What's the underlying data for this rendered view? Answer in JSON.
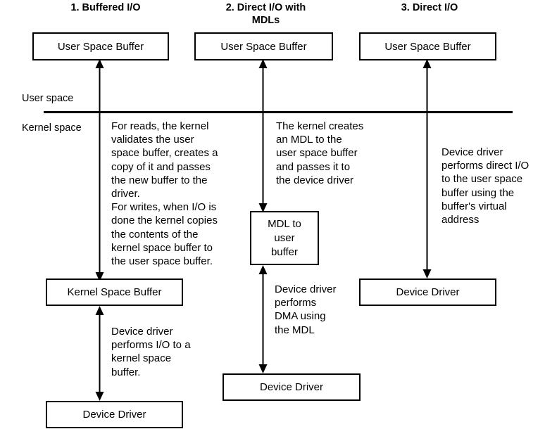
{
  "diagram": {
    "title_columns": [
      {
        "id": "col1",
        "label": "1.  Buffered I/O"
      },
      {
        "id": "col2",
        "label": "2.  Direct I/O with\nMDLs"
      },
      {
        "id": "col3",
        "label": "3. Direct I/O"
      }
    ],
    "space_labels": {
      "user": "User space",
      "kernel": "Kernel space"
    },
    "boxes": [
      {
        "id": "c1-user-space-buffer",
        "label": "User Space Buffer"
      },
      {
        "id": "c2-user-space-buffer",
        "label": "User Space Buffer"
      },
      {
        "id": "c3-user-space-buffer",
        "label": "User Space Buffer"
      },
      {
        "id": "c1-kernel-space-buffer",
        "label": "Kernel Space Buffer"
      },
      {
        "id": "c1-device-driver",
        "label": "Device Driver"
      },
      {
        "id": "c2-mdl-to-user-buffer",
        "label": "MDL to\nuser\nbuffer"
      },
      {
        "id": "c2-device-driver",
        "label": "Device Driver"
      },
      {
        "id": "c3-device-driver",
        "label": "Device Driver"
      }
    ],
    "notes": [
      {
        "id": "c1-note-top",
        "text": "For reads, the kernel\nvalidates the user\nspace buffer, creates a\ncopy of it and passes\nthe new buffer to the\ndriver.\nFor writes, when I/O is\ndone the kernel copies\nthe contents of the\nkernel space buffer to\nthe user space buffer."
      },
      {
        "id": "c1-note-bottom",
        "text": "Device driver\nperforms I/O to a\nkernel space\nbuffer."
      },
      {
        "id": "c2-note-top",
        "text": "The kernel creates\nan MDL to the\nuser space buffer\nand passes it to\nthe device driver"
      },
      {
        "id": "c2-note-bottom",
        "text": "Device driver\nperforms\nDMA using\nthe MDL"
      },
      {
        "id": "c3-note",
        "text": "Device driver\nperforms direct I/O\nto the user space\nbuffer using the\nbuffer's virtual\naddress"
      }
    ],
    "colors": {
      "stroke": "#000000",
      "background": "#ffffff",
      "text": "#000000"
    }
  }
}
